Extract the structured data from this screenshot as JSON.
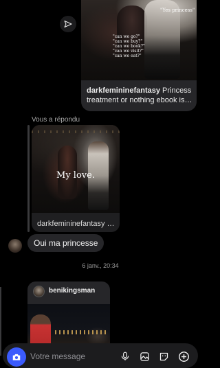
{
  "top_post": {
    "overlay_quote": "\"Yes princess\"",
    "overlay_lines": [
      "\"can we go?\"",
      "\"can we buy?\"",
      "\"can we book?\"",
      "\"can we visit?\"",
      "\"can we eat?\""
    ],
    "username": "darkfemininefantasy",
    "caption_line1": " Princess",
    "caption_line2": "treatment or nothing ebook is li..."
  },
  "reply": {
    "label": "Vous a répondu",
    "image_text": "My love.",
    "caption": "darkfemininefantasy Pr..."
  },
  "message": {
    "text": "Oui ma princesse"
  },
  "timestamp": "6 janv., 20:34",
  "bottom_post": {
    "username": "benikingsman"
  },
  "composer": {
    "placeholder": "Votre message"
  },
  "colors": {
    "accent": "#3b5bfd",
    "bubble": "#262629",
    "background": "#000000"
  },
  "icons": [
    "send-icon",
    "camera-icon",
    "microphone-icon",
    "gallery-icon",
    "sticker-icon",
    "plus-icon"
  ]
}
